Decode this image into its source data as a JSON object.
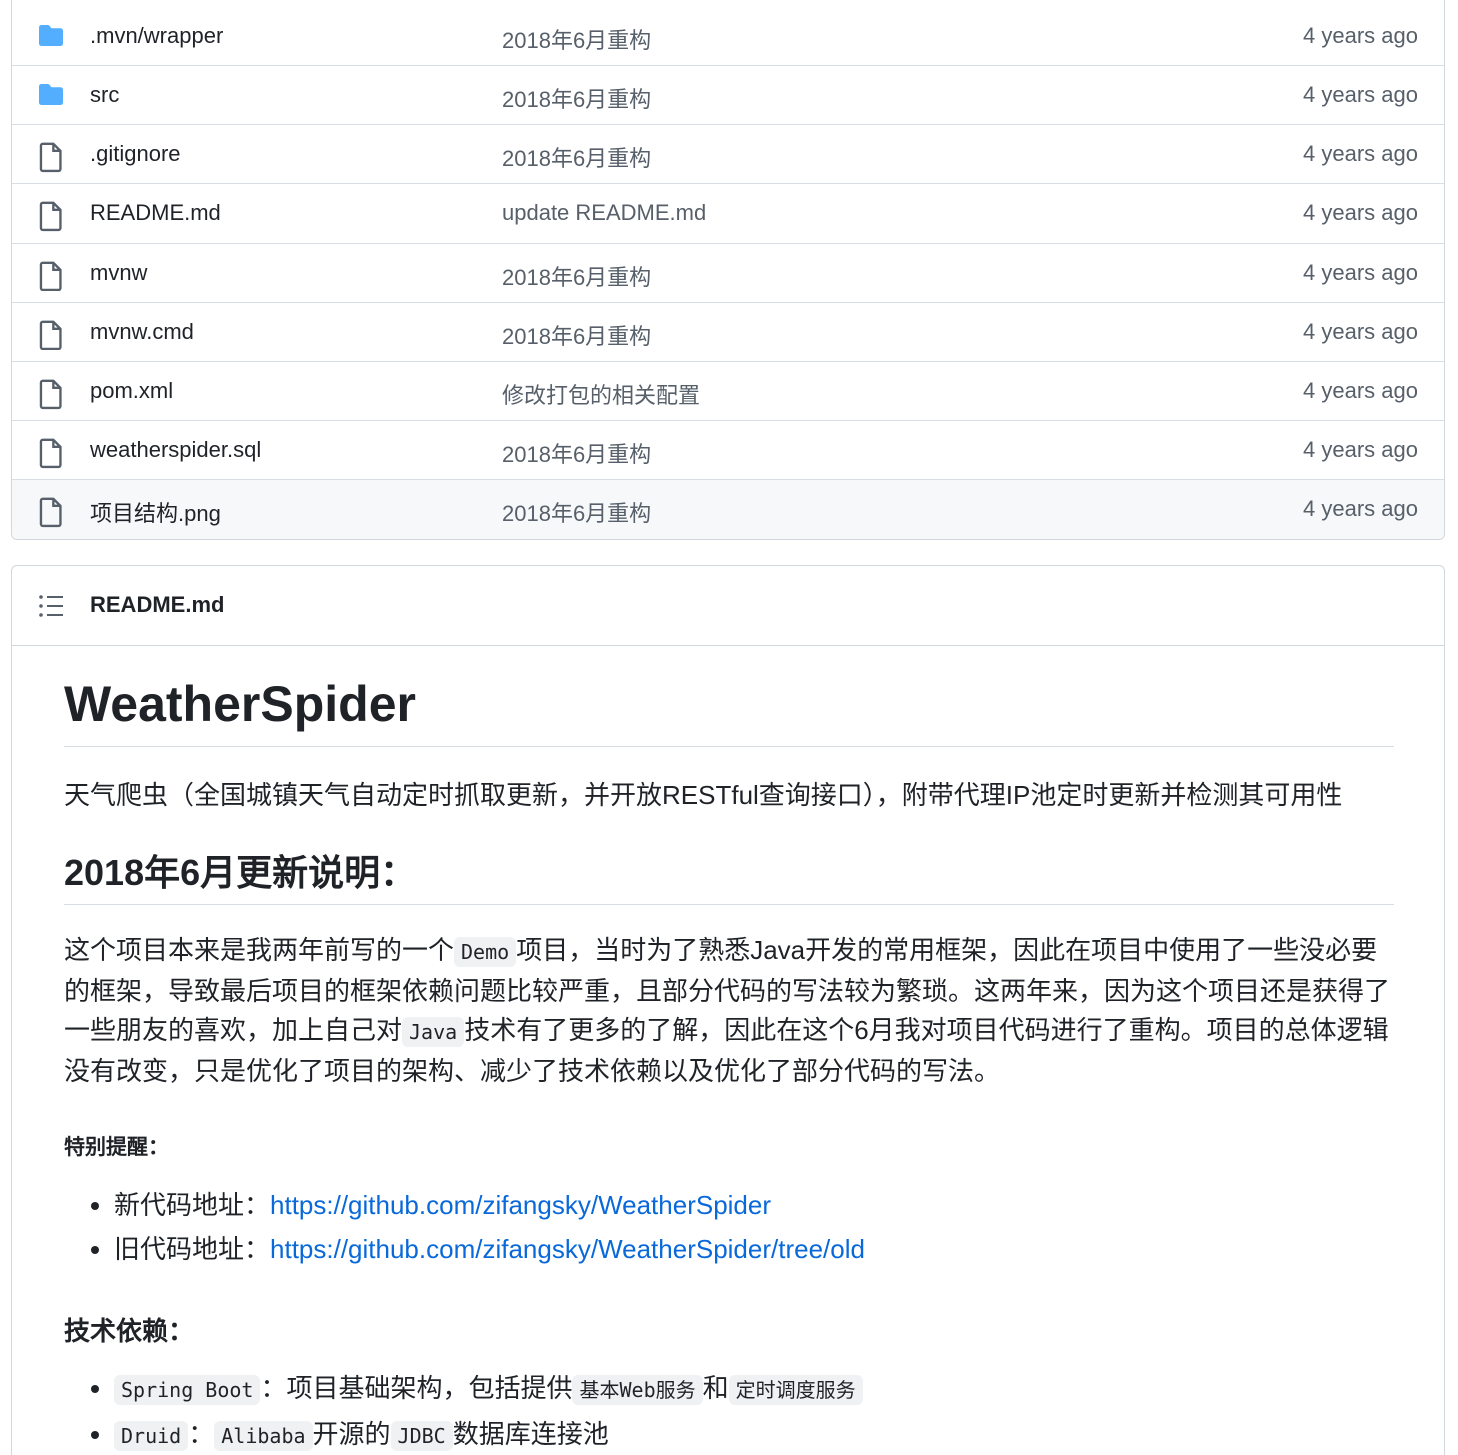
{
  "files": [
    {
      "type": "folder",
      "icon": "folder-icon",
      "name": ".mvn/wrapper",
      "message": "2018年6月重构",
      "age": "4 years ago"
    },
    {
      "type": "folder",
      "icon": "folder-icon",
      "name": "src",
      "message": "2018年6月重构",
      "age": "4 years ago"
    },
    {
      "type": "file",
      "icon": "file-icon",
      "name": ".gitignore",
      "message": "2018年6月重构",
      "age": "4 years ago"
    },
    {
      "type": "file",
      "icon": "file-icon",
      "name": "README.md",
      "message": "update README.md",
      "age": "4 years ago"
    },
    {
      "type": "file",
      "icon": "file-icon",
      "name": "mvnw",
      "message": "2018年6月重构",
      "age": "4 years ago"
    },
    {
      "type": "file",
      "icon": "file-icon",
      "name": "mvnw.cmd",
      "message": "2018年6月重构",
      "age": "4 years ago"
    },
    {
      "type": "file",
      "icon": "file-icon",
      "name": "pom.xml",
      "message": "修改打包的相关配置",
      "age": "4 years ago"
    },
    {
      "type": "file",
      "icon": "file-icon",
      "name": "weatherspider.sql",
      "message": "2018年6月重构",
      "age": "4 years ago"
    },
    {
      "type": "file",
      "icon": "file-icon",
      "name": "项目结构.png",
      "message": "2018年6月重构",
      "age": "4 years ago"
    }
  ],
  "readme": {
    "header_title": "README.md",
    "h1": "WeatherSpider",
    "lead": "天气爬虫（全国城镇天气自动定时抓取更新，并开放RESTful查询接口），附带代理IP池定时更新并检测其可用性",
    "h2": "2018年6月更新说明：",
    "body_1": "这个项目本来是我两年前写的一个",
    "code_demo": "Demo",
    "body_2": "项目，当时为了熟悉Java开发的常用框架，因此在项目中使用了一些没必要的框架，导致最后项目的框架依赖问题比较严重，且部分代码的写法较为繁琐。这两年来，因为这个项目还是获得了一些朋友的喜欢，加上自己对",
    "code_java": "Java",
    "body_3": "技术有了更多的了解，因此在这个6月我对项目代码进行了重构。项目的总体逻辑没有改变，只是优化了项目的架构、减少了技术依赖以及优化了部分代码的写法。",
    "note_heading": "特别提醒：",
    "links": [
      {
        "label": "新代码地址：",
        "url": "https://github.com/zifangsky/WeatherSpider"
      },
      {
        "label": "旧代码地址：",
        "url": "https://github.com/zifangsky/WeatherSpider/tree/old"
      }
    ],
    "deps_heading": "技术依赖：",
    "deps": [
      {
        "code": "Spring Boot",
        "sep": "：",
        "text": "项目基础架构，包括提供",
        "code2": "基本Web服务",
        "text2": "和",
        "code3": "定时调度服务",
        "text3": ""
      },
      {
        "code": "Druid",
        "sep": "：",
        "text": "",
        "code2": "Alibaba",
        "text2": "开源的",
        "code3": "JDBC",
        "text3": "数据库连接池"
      }
    ]
  }
}
